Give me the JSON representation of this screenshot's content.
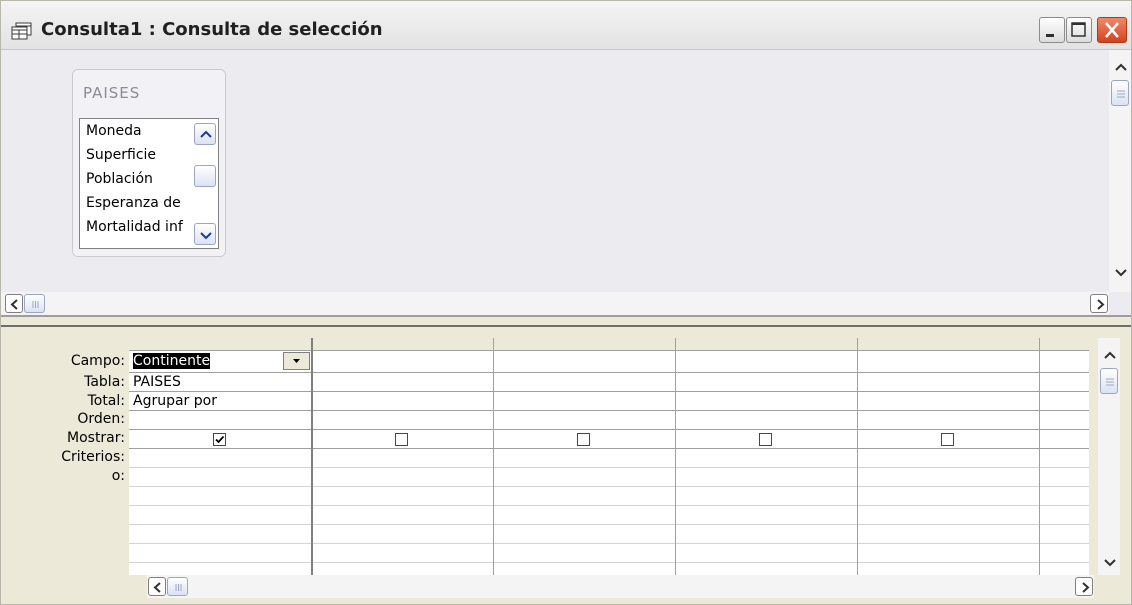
{
  "window": {
    "title": "Consulta1 : Consulta de selección",
    "close_color": "#d4411f"
  },
  "table_pane": {
    "table_name": "PAISES",
    "fields": [
      "Moneda",
      "Superficie",
      "Población",
      "Esperanza de",
      "Mortalidad inf"
    ]
  },
  "grid": {
    "row_labels": {
      "campo": "Campo:",
      "tabla": "Tabla:",
      "total": "Total:",
      "orden": "Orden:",
      "mostrar": "Mostrar:",
      "criterios": "Criterios:",
      "o": "o:"
    },
    "columns": [
      {
        "campo": "Continente",
        "tabla": "PAISES",
        "total": "Agrupar por",
        "orden": "",
        "mostrar": true
      },
      {
        "campo": "",
        "tabla": "",
        "total": "",
        "orden": "",
        "mostrar": false
      },
      {
        "campo": "",
        "tabla": "",
        "total": "",
        "orden": "",
        "mostrar": false
      },
      {
        "campo": "",
        "tabla": "",
        "total": "",
        "orden": "",
        "mostrar": false
      },
      {
        "campo": "",
        "tabla": "",
        "total": "",
        "orden": "",
        "mostrar": false
      }
    ]
  },
  "icons": {
    "title_icon": "query-window-icon",
    "minimize": "minimize-icon",
    "maximize": "maximize-icon",
    "close": "close-icon",
    "dropdown": "chevron-down-icon"
  }
}
